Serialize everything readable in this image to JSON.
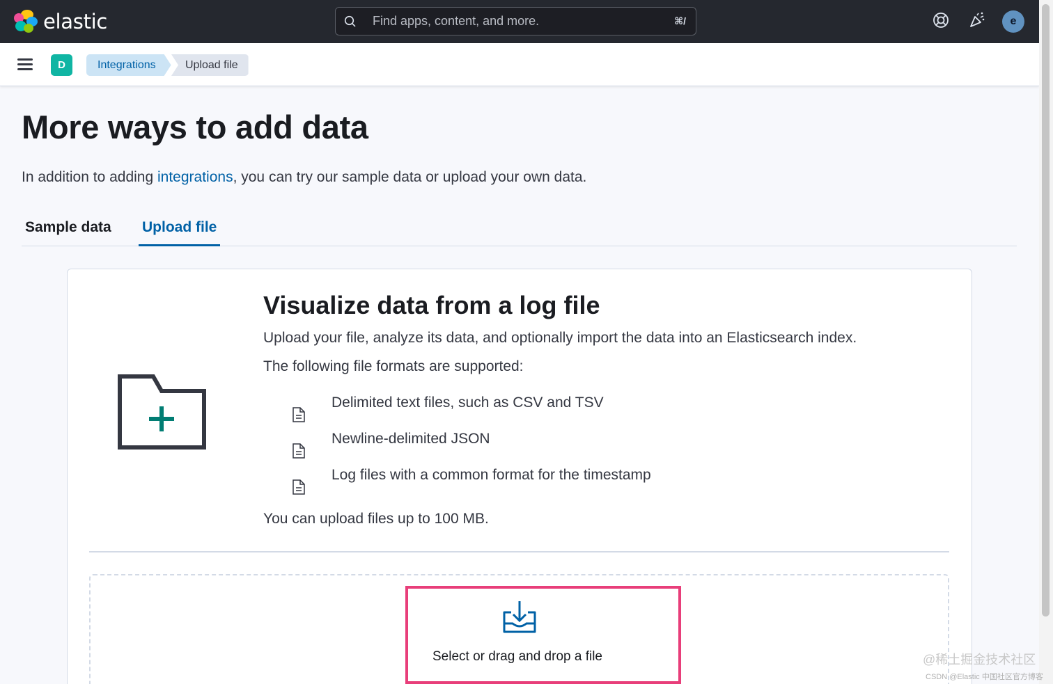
{
  "header": {
    "brand": "elastic",
    "search_placeholder": "Find apps, content, and more.",
    "search_shortcut": "⌘/",
    "avatar_initial": "e",
    "brand_colors": [
      "#f04e98",
      "#fec514",
      "#00bfb3",
      "#1ba9f5",
      "#93c90e"
    ]
  },
  "subheader": {
    "space_initial": "D",
    "breadcrumbs": [
      "Integrations",
      "Upload file"
    ]
  },
  "main": {
    "title": "More ways to add data",
    "intro_prefix": "In addition to adding ",
    "intro_link": "integrations",
    "intro_suffix": ", you can try our sample data or upload your own data.",
    "tabs": [
      {
        "label": "Sample data",
        "selected": false
      },
      {
        "label": "Upload file",
        "selected": true
      }
    ]
  },
  "panel": {
    "title": "Visualize data from a log file",
    "description": "Upload your file, analyze its data, and optionally import the data into an Elasticsearch index.",
    "formats_intro": "The following file formats are supported:",
    "formats": [
      "Delimited text files, such as CSV and TSV",
      "Newline-delimited JSON",
      "Log files with a common format for the timestamp"
    ],
    "size_limit": "You can upload files up to 100 MB.",
    "dropzone_label": "Select or drag and drop a file"
  },
  "watermark": {
    "line1": "@稀土掘金技术社区",
    "line2": "CSDN @Elastic 中国社区官方博客"
  },
  "colors": {
    "accent": "#0061a6",
    "highlight": "#e83e7a",
    "header_bg": "#25282f"
  }
}
